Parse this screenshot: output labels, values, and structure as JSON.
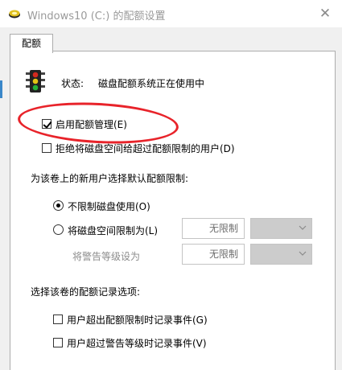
{
  "window": {
    "title": "Windows10 (C:) 的配额设置",
    "close_glyph": "✕"
  },
  "tab": {
    "label": "配额"
  },
  "status": {
    "label": "状态:",
    "value": "磁盘配额系统正在使用中",
    "icon": "traffic-light-icon"
  },
  "options": {
    "enable_quota": {
      "label": "启用配额管理(E)",
      "checked": true
    },
    "deny_space": {
      "label": "拒绝将磁盘空间给超过配额限制的用户(D)",
      "checked": false
    }
  },
  "defaults": {
    "heading": "为该卷上的新用户选择默认配额限制:",
    "no_limit": {
      "label": "不限制磁盘使用(O)",
      "selected": true
    },
    "limit_space": {
      "label": "将磁盘空间限制为(L)",
      "selected": false,
      "value": "无限制"
    },
    "warning_level": {
      "label": "将警告等级设为",
      "value": "无限制"
    }
  },
  "logging": {
    "heading": "选择该卷的配额记录选项:",
    "log_over_limit": {
      "label": "用户超出配额限制时记录事件(G)",
      "checked": false
    },
    "log_over_warning": {
      "label": "用户超过警告等级时记录事件(V)",
      "checked": false
    }
  },
  "colors": {
    "annotation_red": "#e8232a",
    "accent_blue": "#3a87c9"
  }
}
